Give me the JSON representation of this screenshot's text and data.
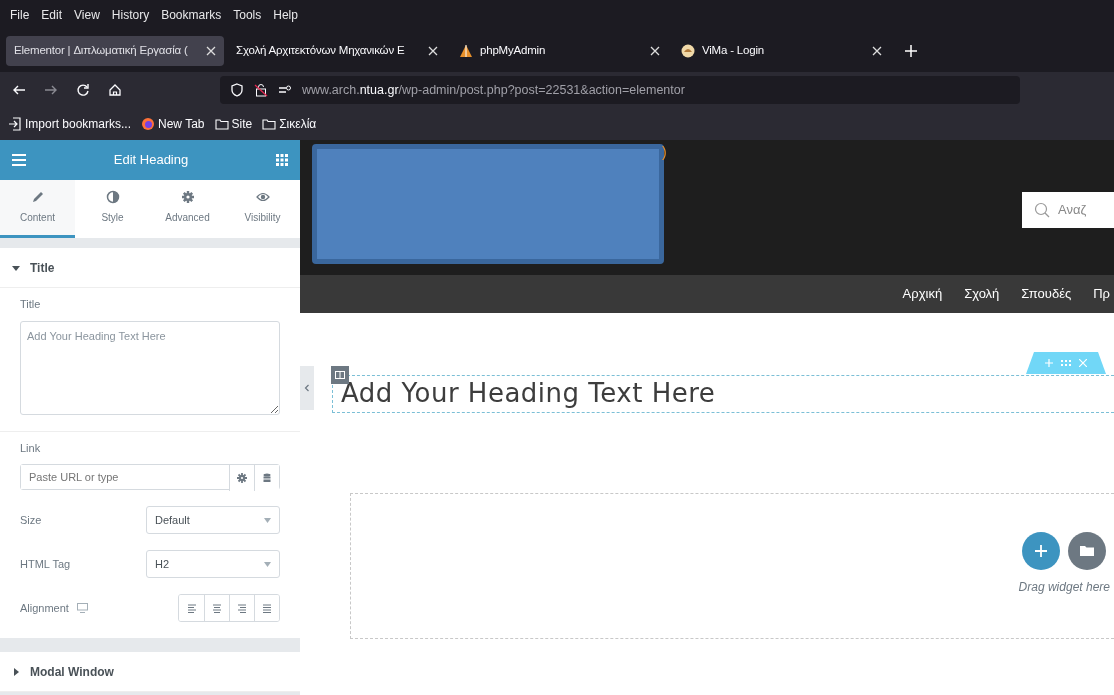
{
  "menu": [
    "File",
    "Edit",
    "View",
    "History",
    "Bookmarks",
    "Tools",
    "Help"
  ],
  "browser_tabs": [
    {
      "label": "Elementor | Διπλωματική Εργασία (",
      "selected": true,
      "kind": "none"
    },
    {
      "label": "Σχολή Αρχιτεκτόνων Μηχανικών Ε",
      "selected": false,
      "kind": "none"
    },
    {
      "label": "phpMyAdmin",
      "selected": false,
      "kind": "sail"
    },
    {
      "label": "ViMa - Login",
      "selected": false,
      "kind": "globe"
    }
  ],
  "address": {
    "before": "www.arch.",
    "domain": "ntua.gr",
    "after": "/wp-admin/post.php?post=22531&action=elementor"
  },
  "bookmarks": [
    {
      "label": "Import bookmarks...",
      "kind": "import"
    },
    {
      "label": "New Tab",
      "kind": "firefox"
    },
    {
      "label": "Site",
      "kind": "folder"
    },
    {
      "label": "Σικελία",
      "kind": "folder"
    }
  ],
  "panel": {
    "title": "Edit Heading",
    "tabs": [
      {
        "label": "Content",
        "kind": "pencil",
        "selected": true
      },
      {
        "label": "Style",
        "kind": "contrast",
        "selected": false
      },
      {
        "label": "Advanced",
        "kind": "gear",
        "selected": false
      },
      {
        "label": "Visibility",
        "kind": "eye",
        "selected": false
      }
    ],
    "sections": [
      {
        "title": "Title",
        "expanded": true
      },
      {
        "title": "Modal Window",
        "expanded": false
      }
    ],
    "title_label": "Title",
    "title_value": "Add Your Heading Text Here",
    "link_label": "Link",
    "link_placeholder": "Paste URL or type",
    "size_label": "Size",
    "size_value": "Default",
    "tag_label": "HTML Tag",
    "tag_value": "H2",
    "alignment_label": "Alignment"
  },
  "site": {
    "orange_mark": ")",
    "search_placeholder": "Αναζ",
    "nav": [
      "Αρχική",
      "Σχολή",
      "Σπουδές",
      "Πρ"
    ],
    "heading": "Add Your Heading Text Here",
    "drop_hint": "Drag widget here"
  }
}
